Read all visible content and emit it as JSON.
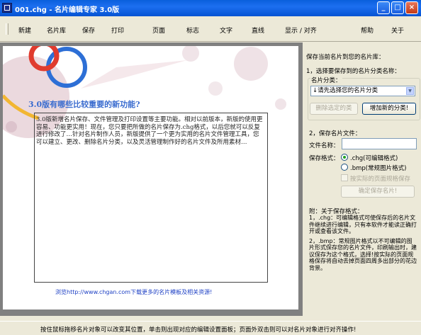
{
  "window": {
    "title": "001.chg - 名片编辑专家 3.0版",
    "min_label": "_",
    "max_label": "□",
    "close_label": "×"
  },
  "menu": {
    "new": "新建",
    "library": "名片库",
    "save": "保存",
    "print": "打印",
    "page": "页面",
    "logo": "标志",
    "text": "文字",
    "line": "直线",
    "display_align": "显示 / 对齐",
    "help": "帮助",
    "close": "关于"
  },
  "card": {
    "title": "3.0版有哪些比较重要的新功能?",
    "body": "3.0版新增名片保存、文件管理及打印设置等主要功能。相对以前版本，新版的使用更容易、功能更实用！现在，您只要把所做的名片保存为.chg格式，以后您就可以反复进行修改了…针对名片制作人员，新版提供了一个更为实用的名片文件管理工具，您可以建立、更改、删除名片分类，以及灵活管理制作好的名片文件及所用素材…",
    "link": "浏览http://www.chgan.com下载更多的名片模板及相关资源!"
  },
  "panel": {
    "heading": "保存当前名片到您的名片库：",
    "step1": "1，选择要保存到的名片分类名称：",
    "category_label": "名片分类：",
    "category_select": "↓请先选择您的名片分类",
    "delete_category_btn": "删除选定的类",
    "add_category_btn": "增加新的分类!",
    "step2": "2，保存名片文件：",
    "filename_label": "文件名称：",
    "filename_value": "",
    "format_label": "保存格式：",
    "format_chg": ".chg(可编辑格式)",
    "format_bmp": ".bmp(常规图片格式)",
    "save_page_setting": "按实际的页面规格保存",
    "confirm_btn": "确定保存名片!",
    "notes_title": "附：关于保存格式：",
    "note1": "1，.chg：可编辑格式可使保存后的名片文件继续进行编辑，只有本软件才能读正确打开或查看该文件。",
    "note2": "2，.bmp：常规图片格式以不可编辑的图片形式保存您的名片文件，印刷输出时，建议保存为这个格式，选择!按实际的页面规格保存将自动去掉页面四周多出部分的花边背景。"
  },
  "status": {
    "text": "按住鼠标拖移名片对象可以改变其位置，单击则出现对应的编辑设置面板；页面外双击则可以对名片对象进行对齐操作!"
  },
  "colors": {
    "title_bar": "#0a5fdc",
    "card_title": "#3a6ccf",
    "link": "#1c3fc4",
    "radio_dot": "#21a121"
  }
}
